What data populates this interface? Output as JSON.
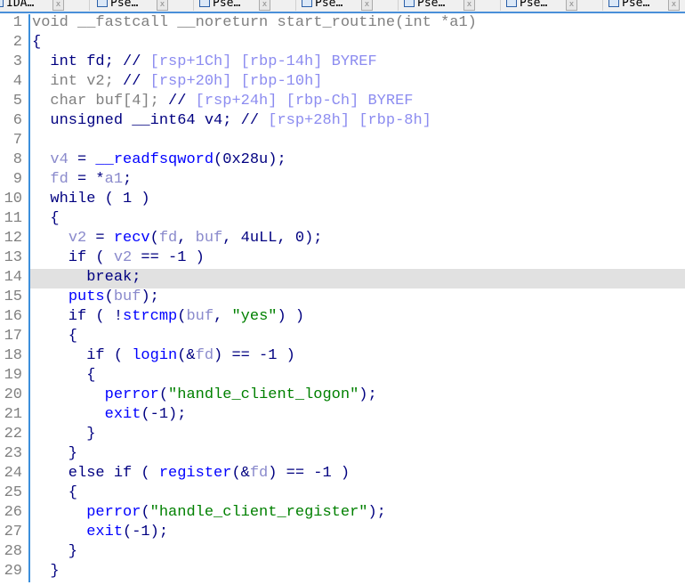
{
  "tabs": [
    {
      "label": "IDA…"
    },
    {
      "label": "Pse…"
    },
    {
      "label": "Pse…"
    },
    {
      "label": "Pse…"
    },
    {
      "label": "Pse…"
    },
    {
      "label": "Pse…"
    },
    {
      "label": "Pse…"
    }
  ],
  "highlight_line": 14,
  "colors": {
    "keyword": "#000080",
    "function": "#0000ff",
    "variable": "#8a8acc",
    "gray": "#808080",
    "comment": "#8c8cf0",
    "string": "#008000"
  },
  "lines": [
    [
      [
        "g",
        "void __fastcall __noreturn start_routine(int *a1)"
      ]
    ],
    [
      [
        "k",
        "{"
      ]
    ],
    [
      [
        "k",
        "  int fd; // "
      ],
      [
        "c",
        "[rsp+1Ch] [rbp-14h] BYREF"
      ]
    ],
    [
      [
        "g",
        "  int v2;"
      ],
      [
        "k",
        " // "
      ],
      [
        "c",
        "[rsp+20h] [rbp-10h]"
      ]
    ],
    [
      [
        "g",
        "  char buf[4];"
      ],
      [
        "k",
        " // "
      ],
      [
        "c",
        "[rsp+24h] [rbp-Ch] BYREF"
      ]
    ],
    [
      [
        "k",
        "  unsigned __int64 v4; // "
      ],
      [
        "c",
        "[rsp+28h] [rbp-8h]"
      ]
    ],
    [
      [
        "k",
        ""
      ]
    ],
    [
      [
        "k",
        "  "
      ],
      [
        "v",
        "v4"
      ],
      [
        "k",
        " = "
      ],
      [
        "f",
        "__readfsqword"
      ],
      [
        "k",
        "(0x28u);"
      ]
    ],
    [
      [
        "k",
        "  "
      ],
      [
        "v",
        "fd"
      ],
      [
        "k",
        " = *"
      ],
      [
        "v",
        "a1"
      ],
      [
        "k",
        ";"
      ]
    ],
    [
      [
        "k",
        "  while ( 1 )"
      ]
    ],
    [
      [
        "k",
        "  {"
      ]
    ],
    [
      [
        "k",
        "    "
      ],
      [
        "v",
        "v2"
      ],
      [
        "k",
        " = "
      ],
      [
        "f",
        "recv"
      ],
      [
        "k",
        "("
      ],
      [
        "v",
        "fd"
      ],
      [
        "k",
        ", "
      ],
      [
        "v",
        "buf"
      ],
      [
        "k",
        ", 4uLL, 0);"
      ]
    ],
    [
      [
        "k",
        "    if ( "
      ],
      [
        "v",
        "v2"
      ],
      [
        "k",
        " == -1 )"
      ]
    ],
    [
      [
        "k",
        "      break;"
      ]
    ],
    [
      [
        "k",
        "    "
      ],
      [
        "f",
        "puts"
      ],
      [
        "k",
        "("
      ],
      [
        "v",
        "buf"
      ],
      [
        "k",
        ");"
      ]
    ],
    [
      [
        "k",
        "    if ( !"
      ],
      [
        "f",
        "strcmp"
      ],
      [
        "k",
        "("
      ],
      [
        "v",
        "buf"
      ],
      [
        "k",
        ", "
      ],
      [
        "s",
        "\"yes\""
      ],
      [
        "k",
        ") )"
      ]
    ],
    [
      [
        "k",
        "    {"
      ]
    ],
    [
      [
        "k",
        "      if ( "
      ],
      [
        "f",
        "login"
      ],
      [
        "k",
        "(&"
      ],
      [
        "v",
        "fd"
      ],
      [
        "k",
        ") == -1 )"
      ]
    ],
    [
      [
        "k",
        "      {"
      ]
    ],
    [
      [
        "k",
        "        "
      ],
      [
        "f",
        "perror"
      ],
      [
        "k",
        "("
      ],
      [
        "s",
        "\"handle_client_logon\""
      ],
      [
        "k",
        ");"
      ]
    ],
    [
      [
        "k",
        "        "
      ],
      [
        "f",
        "exit"
      ],
      [
        "k",
        "(-1);"
      ]
    ],
    [
      [
        "k",
        "      }"
      ]
    ],
    [
      [
        "k",
        "    }"
      ]
    ],
    [
      [
        "k",
        "    else if ( "
      ],
      [
        "f",
        "register"
      ],
      [
        "k",
        "(&"
      ],
      [
        "v",
        "fd"
      ],
      [
        "k",
        ") == -1 )"
      ]
    ],
    [
      [
        "k",
        "    {"
      ]
    ],
    [
      [
        "k",
        "      "
      ],
      [
        "f",
        "perror"
      ],
      [
        "k",
        "("
      ],
      [
        "s",
        "\"handle_client_register\""
      ],
      [
        "k",
        ");"
      ]
    ],
    [
      [
        "k",
        "      "
      ],
      [
        "f",
        "exit"
      ],
      [
        "k",
        "(-1);"
      ]
    ],
    [
      [
        "k",
        "    }"
      ]
    ],
    [
      [
        "k",
        "  }"
      ]
    ]
  ]
}
